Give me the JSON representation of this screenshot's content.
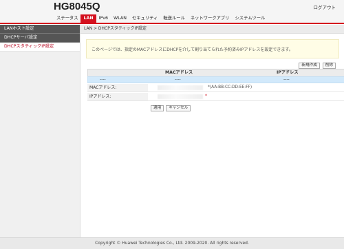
{
  "header": {
    "model": "HG8045Q",
    "logout": "ログアウト",
    "nav": [
      "ステータス",
      "LAN",
      "IPv6",
      "WLAN",
      "セキュリティ",
      "転送ルール",
      "ネットワークアプリ",
      "システムツール"
    ],
    "active_nav": "LAN"
  },
  "sidebar": {
    "items": [
      {
        "label": "LANホスト設定"
      },
      {
        "label": "DHCPサーバ設定"
      },
      {
        "label": "DHCPスタティックIP設定"
      }
    ],
    "active_index": 2
  },
  "main": {
    "breadcrumb": "LAN > DHCPスタティックIP設定",
    "info": "このページでは、指定のMACアドレスにDHCPを介して割り当てられた予約済みIPアドレスを設定できます。",
    "new_button": "新規作成",
    "delete_button": "削除",
    "table": {
      "headers": [
        "MACアドレス",
        "IPアドレス"
      ],
      "empty_row": [
        "----",
        "----",
        "----"
      ]
    },
    "form": {
      "mac_label": "MACアドレス:",
      "mac_hint": "*(AA:BB:CC:DD:EE:FF)",
      "ip_label": "IPアドレス:",
      "ip_required": "*"
    },
    "apply_button": "適用",
    "cancel_button": "キャンセル"
  },
  "footer": {
    "copyright": "Copyright © Huawei Technologies Co., Ltd. 2009-2020. All rights reserved."
  },
  "colors": {
    "accent": "#d4101e",
    "sidebar_dark": "#555555",
    "table_empty_row": "#d2e9fb",
    "info_background": "#fffde6"
  }
}
